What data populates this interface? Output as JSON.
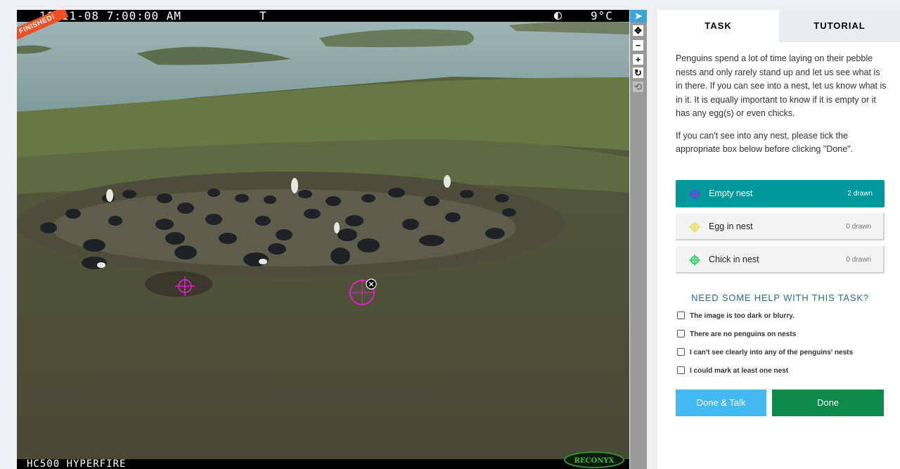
{
  "viewer": {
    "status_ribbon": "FINISHED!",
    "camera_timestamp": "16-11-08 7:00:00 AM",
    "camera_temp_mode": "T",
    "camera_temperature": "9°C",
    "camera_model": "HC500 HYPERFIRE",
    "camera_brand": "RECONYX",
    "moon_icon": "moon-phase-icon",
    "marks": [
      {
        "type": "empty-nest",
        "color": "#e020c8",
        "selected": false
      },
      {
        "type": "empty-nest",
        "color": "#e020c8",
        "selected": true
      }
    ]
  },
  "toolbar": {
    "items": [
      {
        "name": "pointer-tool",
        "icon": "cursor-arrow-icon",
        "glyph": "➤",
        "active": true
      },
      {
        "name": "pan-tool",
        "icon": "move-arrows-icon",
        "glyph": "✥",
        "active": false
      },
      {
        "name": "zoom-out-tool",
        "icon": "minus-icon",
        "glyph": "−",
        "active": false
      },
      {
        "name": "zoom-in-tool",
        "icon": "plus-icon",
        "glyph": "+",
        "active": false
      },
      {
        "name": "rotate-tool",
        "icon": "rotate-icon",
        "glyph": "↻",
        "active": false
      },
      {
        "name": "reset-tool",
        "icon": "refresh-icon",
        "glyph": "⟲",
        "active": false,
        "disabled": true
      }
    ]
  },
  "panel": {
    "tabs": [
      {
        "label": "TASK",
        "active": true
      },
      {
        "label": "TUTORIAL",
        "active": false
      }
    ],
    "instructions": [
      "Penguins spend a lot of time laying on their pebble nests and only rarely stand up and let us see what is in there. If you can see into a nest, let us know what is in it. It is equally important to know if it is empty or it has any egg(s) or even chicks.",
      "If you can't see into any nest, please tick the appropriate box below before clicking \"Done\"."
    ],
    "tools": [
      {
        "label": "Empty nest",
        "count": "2 drawn",
        "color": "#7b3fe4",
        "selected": true
      },
      {
        "label": "Egg in nest",
        "count": "0 drawn",
        "color": "#e8e06a",
        "selected": false
      },
      {
        "label": "Chick in nest",
        "count": "0 drawn",
        "color": "#3cd070",
        "selected": false
      }
    ],
    "help_heading": "NEED SOME HELP WITH THIS TASK?",
    "checkboxes": [
      {
        "label": "The image is too dark or blurry.",
        "checked": false
      },
      {
        "label": "There are no penguins on nests",
        "checked": false
      },
      {
        "label": "I can't see clearly into any of the penguins' nests",
        "checked": false
      },
      {
        "label": "I could mark at least one nest",
        "checked": false
      }
    ],
    "buttons": {
      "done_talk": "Done & Talk",
      "done": "Done"
    }
  }
}
